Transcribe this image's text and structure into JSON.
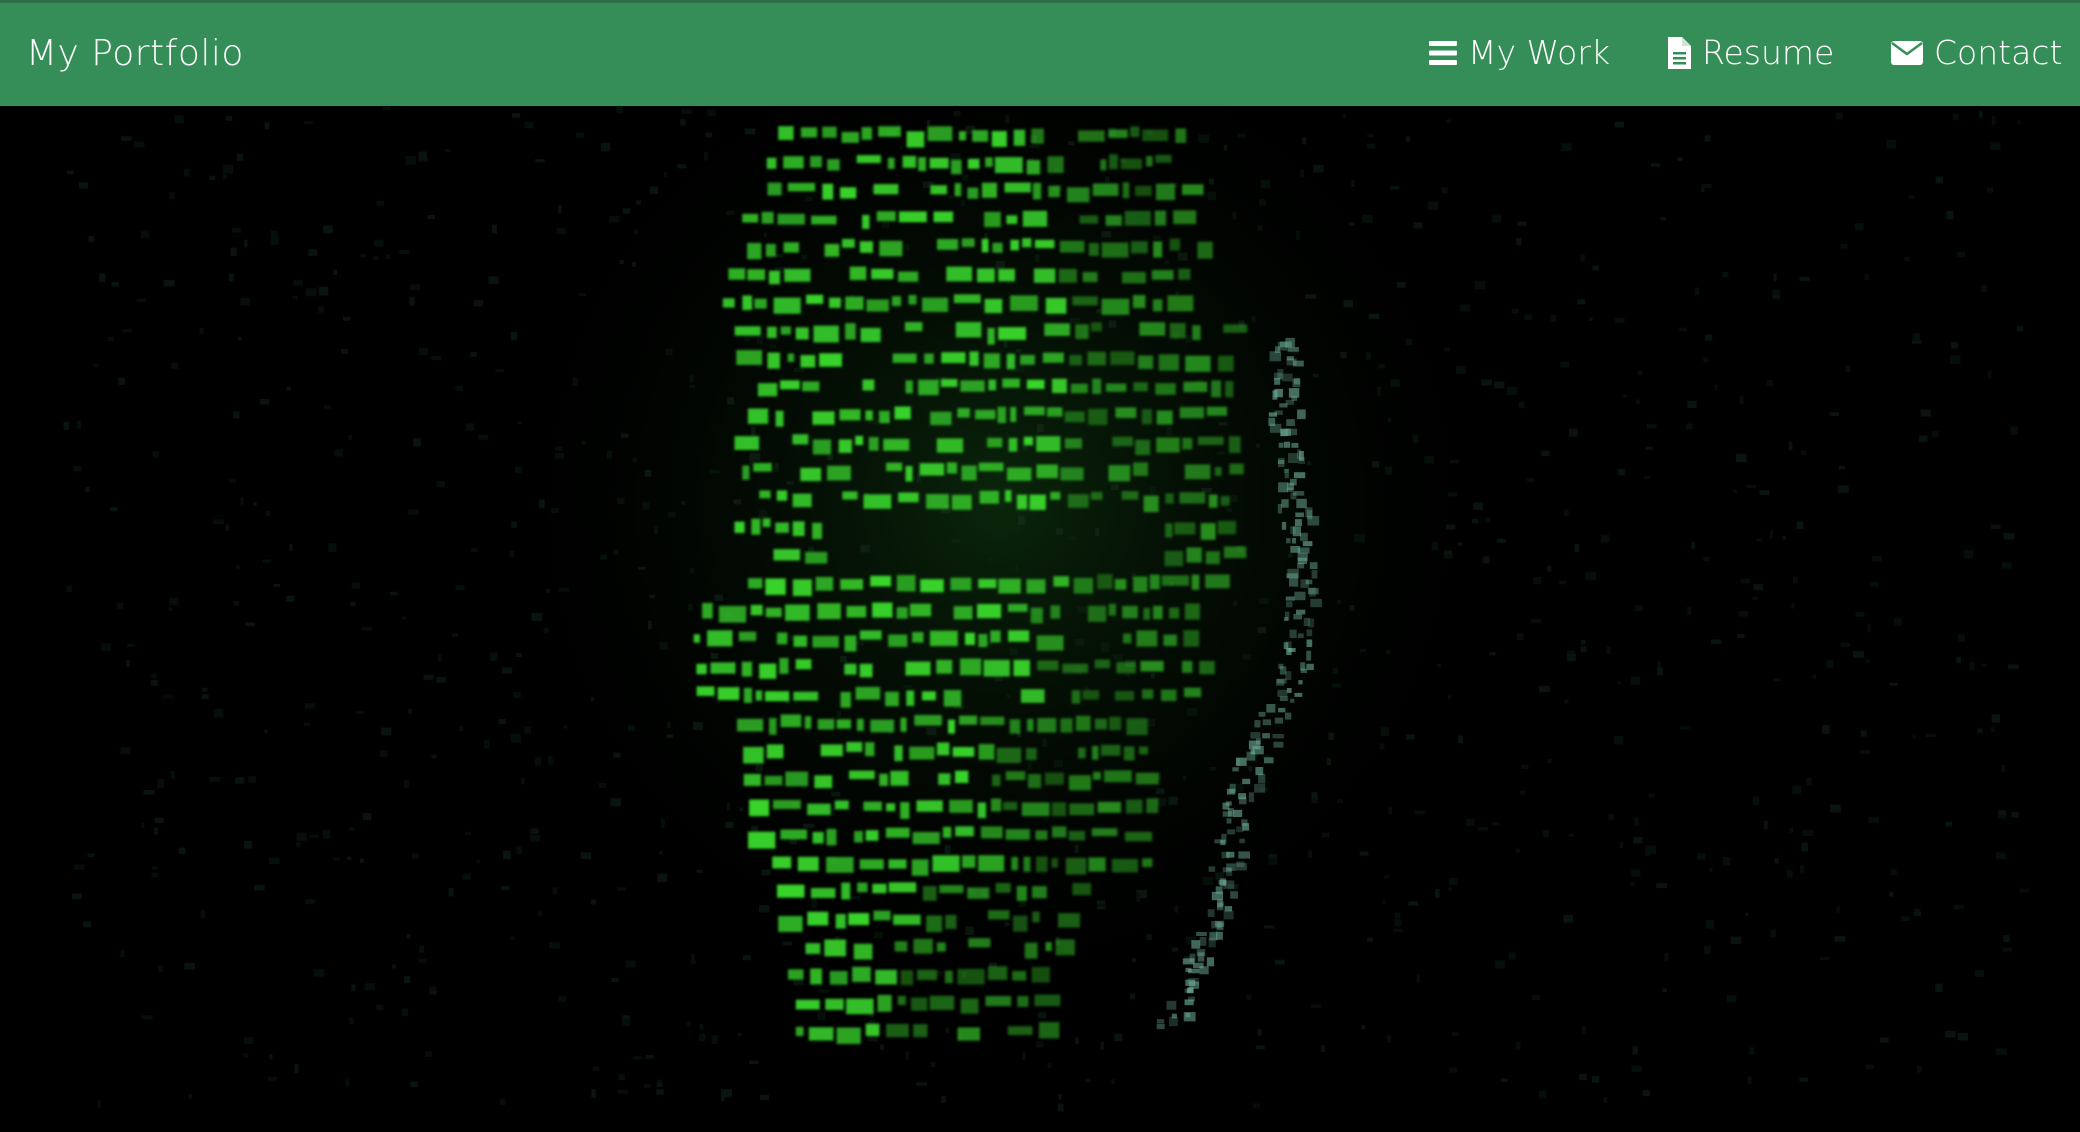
{
  "navbar": {
    "brand": "My Portfolio",
    "links": [
      {
        "label": "My Work",
        "icon": "bars-icon"
      },
      {
        "label": "Resume",
        "icon": "file-icon"
      },
      {
        "label": "Contact",
        "icon": "envelope-icon"
      }
    ]
  },
  "hero": {
    "image": "matrix-code-face"
  },
  "colors": {
    "navbar_bg": "#358e58",
    "text": "#ffffff",
    "hero_bg": "#000000",
    "matrix_green": "#39d52c"
  }
}
